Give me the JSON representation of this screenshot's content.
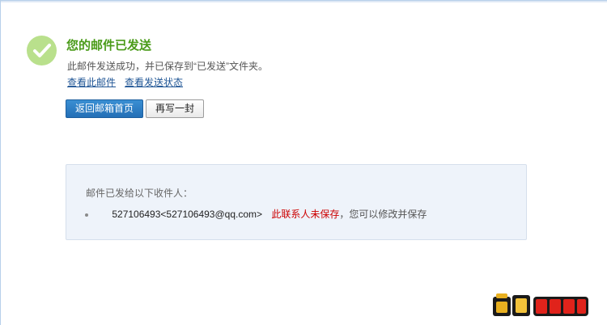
{
  "status": {
    "title": "您的邮件已发送",
    "message": "此邮件发送成功，并已保存到“已发送”文件夹。"
  },
  "links": {
    "view_mail": "查看此邮件",
    "view_status": "查看发送状态"
  },
  "buttons": {
    "back_inbox": "返回邮箱首页",
    "compose_another": "再写一封"
  },
  "recipients": {
    "heading": "邮件已发给以下收件人：",
    "items": [
      {
        "address": "527106493<527106493@qq.com>",
        "unsaved_note": "此联系人未保存",
        "save_hint": "，您可以修改并保存"
      }
    ]
  },
  "colors": {
    "success_green": "#4a9b19",
    "success_icon_bg": "#b9e08c",
    "link_blue": "#1e5494",
    "primary_button": "#2a7cc4",
    "warning_red": "#cc0000",
    "panel_bg": "#eef3fa"
  },
  "icons": {
    "status": "checkmark-circle-icon",
    "bullet": "bullet-icon",
    "watermark": "site-logo"
  }
}
